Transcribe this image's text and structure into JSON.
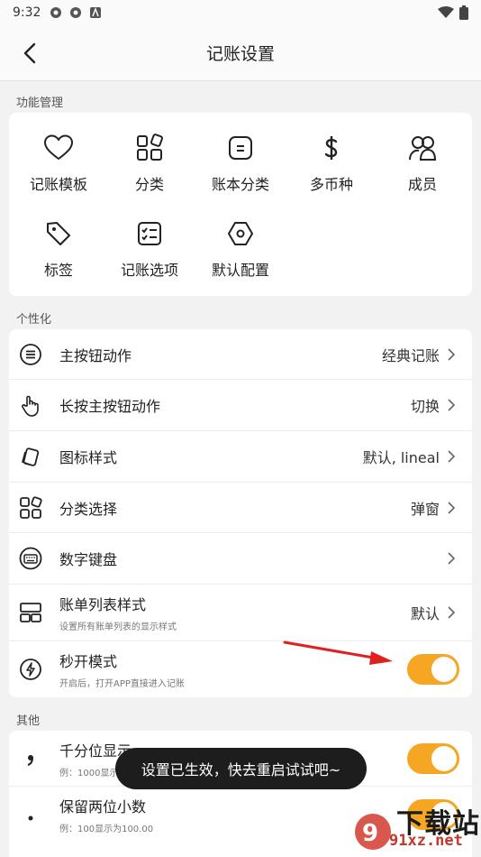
{
  "status_bar": {
    "time": "9:32"
  },
  "app_bar": {
    "title": "记账设置"
  },
  "sections": {
    "features": "功能管理",
    "personalize": "个性化",
    "others": "其他"
  },
  "features": [
    {
      "label": "记账模板",
      "icon": "heart-icon"
    },
    {
      "label": "分类",
      "icon": "category-grid-icon"
    },
    {
      "label": "账本分类",
      "icon": "ledger-icon"
    },
    {
      "label": "多币种",
      "icon": "dollar-icon"
    },
    {
      "label": "成员",
      "icon": "members-icon"
    },
    {
      "label": "标签",
      "icon": "tag-icon"
    },
    {
      "label": "记账选项",
      "icon": "checklist-icon"
    },
    {
      "label": "默认配置",
      "icon": "hexagon-icon"
    }
  ],
  "personal_rows": [
    {
      "title": "主按钮动作",
      "value": "经典记账",
      "icon": "menu-lines-icon"
    },
    {
      "title": "长按主按钮动作",
      "value": "切换",
      "icon": "hand-touch-icon"
    },
    {
      "title": "图标样式",
      "value": "默认, lineal",
      "icon": "icon-style-icon"
    },
    {
      "title": "分类选择",
      "value": "弹窗",
      "icon": "category-select-icon"
    },
    {
      "title": "数字键盘",
      "value": "",
      "icon": "keyboard-icon"
    },
    {
      "title": "账单列表样式",
      "sub": "设置所有账单列表的显示样式",
      "value": "默认",
      "icon": "list-style-icon"
    },
    {
      "title": "秒开模式",
      "sub": "开启后，打开APP直接进入记账",
      "toggle": true,
      "icon": "lightning-icon"
    }
  ],
  "other_rows": [
    {
      "title": "千分位显示",
      "sub": "例：1000显示",
      "toggle": true,
      "icon": "comma-icon"
    },
    {
      "title": "保留两位小数",
      "sub": "例：100显示为100.00",
      "toggle": true,
      "icon": "dot-icon"
    }
  ],
  "toast": "设置已生效，快去重启试试吧~",
  "watermark": {
    "big": "下载站",
    "small": "91xz.net"
  },
  "colors": {
    "accent": "#f5a623",
    "arrow": "#e02020"
  }
}
